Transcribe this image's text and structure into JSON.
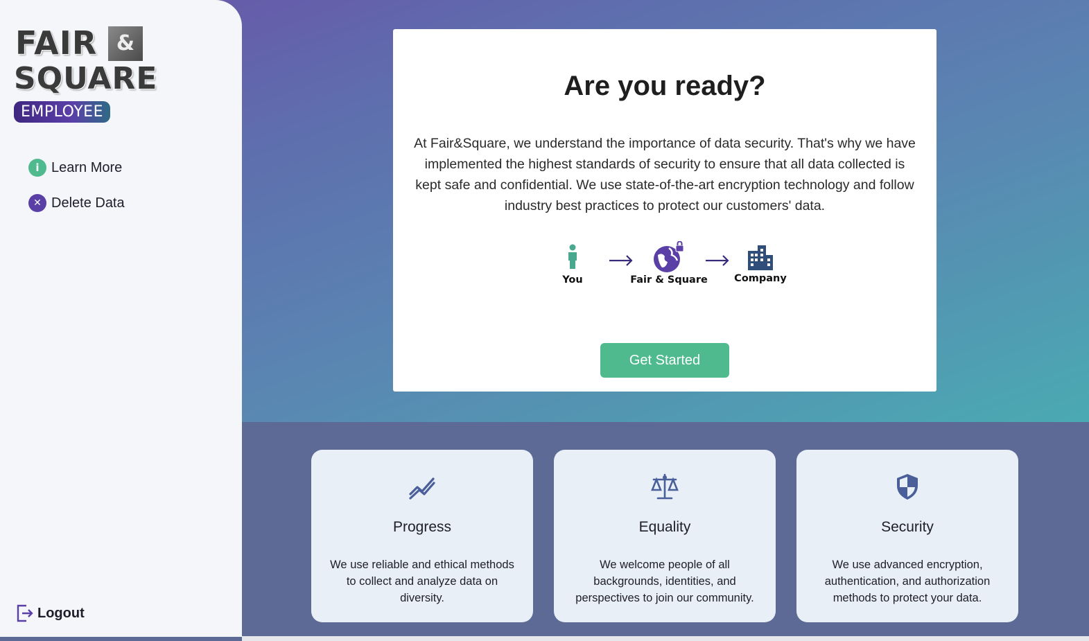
{
  "brand": {
    "line1": "FAIR",
    "ampersand": "&",
    "line2": "SQUARE",
    "badge": "EMPLOYEE"
  },
  "sidebar": {
    "items": [
      {
        "label": "Learn More",
        "icon": "info-icon",
        "glyph": "i",
        "color": "#4fba8e"
      },
      {
        "label": "Delete Data",
        "icon": "close-circle-icon",
        "glyph": "✕",
        "color": "#5a3fa6"
      }
    ],
    "logout_label": "Logout"
  },
  "hero": {
    "title": "Are you ready?",
    "body": "At Fair&Square, we understand the importance of data security. That's why we have implemented the highest standards of security to ensure that all data collected is kept safe and confidential. We use state-of-the-art encryption technology and follow industry best practices to protect our customers' data.",
    "flow": [
      {
        "label": "You",
        "icon": "person-icon"
      },
      {
        "label": "Fair & Square",
        "icon": "secure-globe-icon"
      },
      {
        "label": "Company",
        "icon": "building-icon"
      }
    ],
    "cta_label": "Get Started"
  },
  "features": [
    {
      "title": "Progress",
      "icon": "trend-up-icon",
      "desc": "We use reliable and ethical methods to collect and analyze data on diversity."
    },
    {
      "title": "Equality",
      "icon": "scales-icon",
      "desc": "We welcome people of all backgrounds, identities, and perspectives to join our community."
    },
    {
      "title": "Security",
      "icon": "shield-icon",
      "desc": "We use advanced encryption, authentication, and authorization methods to protect your data."
    }
  ],
  "colors": {
    "accent_green": "#4fba8e",
    "accent_purple": "#5a3fa6",
    "icon_blue": "#4a5f9a",
    "bottom_band": "#5d6a96"
  }
}
